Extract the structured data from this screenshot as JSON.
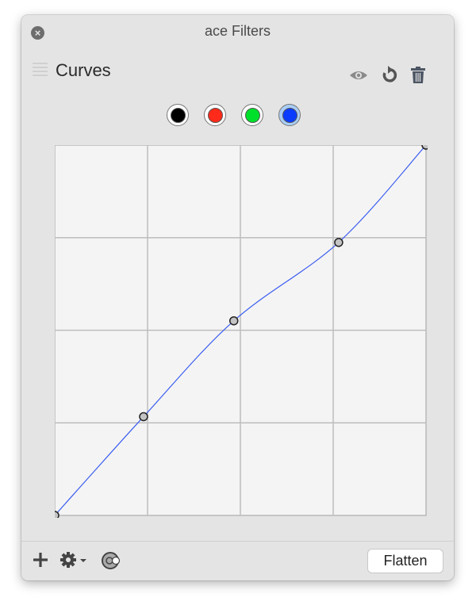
{
  "window": {
    "title": "ace Filters"
  },
  "filter": {
    "name": "Curves"
  },
  "channels": [
    {
      "name": "black",
      "color": "#000000",
      "selected": false
    },
    {
      "name": "red",
      "color": "#ff2a1a",
      "selected": false
    },
    {
      "name": "green",
      "color": "#00e02a",
      "selected": false
    },
    {
      "name": "blue",
      "color": "#0a3cff",
      "selected": true
    }
  ],
  "curve": {
    "color": "#3a5cf0",
    "grid_divisions": 4,
    "range": [
      0,
      255
    ],
    "points": [
      [
        0,
        0
      ],
      [
        61,
        68
      ],
      [
        123,
        134
      ],
      [
        195,
        188
      ],
      [
        255,
        255
      ]
    ]
  },
  "footer": {
    "flatten_label": "Flatten"
  },
  "icons": [
    "close-icon",
    "drag-handle-icon",
    "eye-icon",
    "reset-icon",
    "trash-icon",
    "plus-icon",
    "gear-icon",
    "chevron-down-icon",
    "mask-icon"
  ]
}
